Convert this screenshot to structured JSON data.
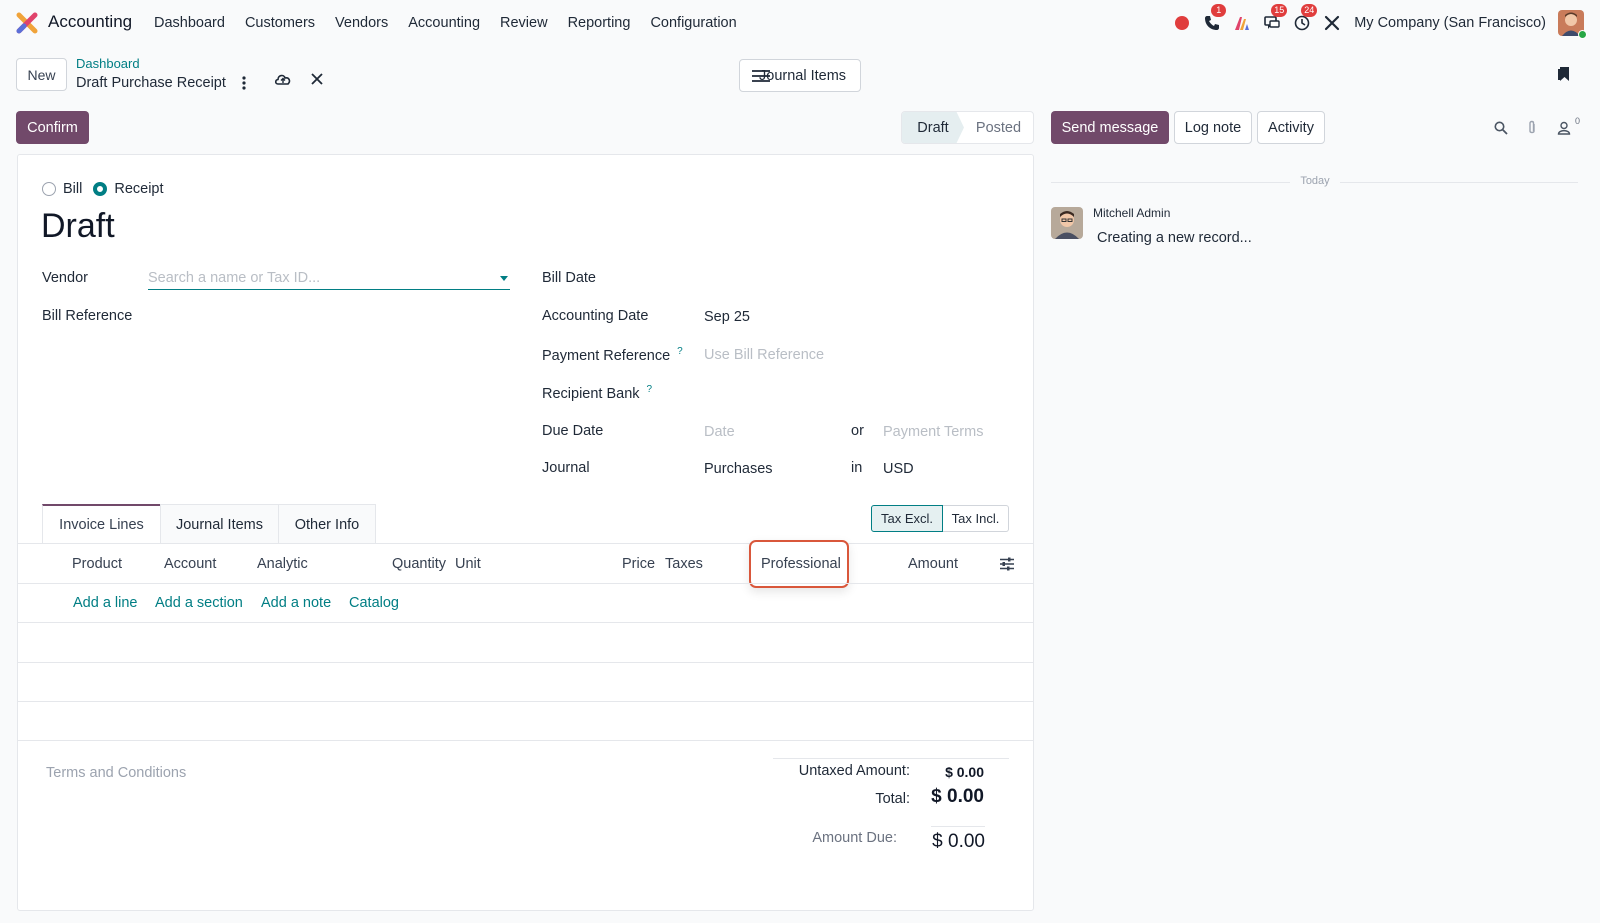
{
  "app": {
    "name": "Accounting"
  },
  "menu": [
    "Dashboard",
    "Customers",
    "Vendors",
    "Accounting",
    "Review",
    "Reporting",
    "Configuration"
  ],
  "systray": {
    "items": [
      {
        "icon": "record-dot-icon",
        "badge": ""
      },
      {
        "icon": "phone-icon",
        "badge": "1"
      },
      {
        "icon": "ai-icon",
        "badge": ""
      },
      {
        "icon": "chat-icon",
        "badge": "15"
      },
      {
        "icon": "clock-icon",
        "badge": "24"
      },
      {
        "icon": "tools-icon",
        "badge": ""
      }
    ],
    "company": "My Company (San Francisco)"
  },
  "control_panel": {
    "new_label": "New",
    "breadcrumb": "Dashboard",
    "record_name": "Draft Purchase Receipt",
    "journal_items_label": "Journal Items",
    "confirm_label": "Confirm",
    "status": [
      "Draft",
      "Posted"
    ]
  },
  "chatter": {
    "send_message": "Send message",
    "log_note": "Log note",
    "activity": "Activity",
    "follower_count": "0",
    "today": "Today",
    "message": {
      "author": "Mitchell Admin",
      "body": "Creating a new record..."
    }
  },
  "form": {
    "type_options": [
      "Bill",
      "Receipt"
    ],
    "selected_type": "Receipt",
    "title": "Draft",
    "vendor_label": "Vendor",
    "vendor_placeholder": "Search a name or Tax ID...",
    "bill_reference_label": "Bill Reference",
    "bill_date_label": "Bill Date",
    "accounting_date_label": "Accounting Date",
    "accounting_date_value": "Sep 25",
    "payment_reference_label": "Payment Reference",
    "payment_reference_placeholder": "Use Bill Reference",
    "recipient_bank_label": "Recipient Bank",
    "help_mark": "?",
    "due_date_label": "Due Date",
    "due_date_placeholder": "Date",
    "or_label": "or",
    "payment_terms_placeholder": "Payment Terms",
    "journal_label": "Journal",
    "journal_value": "Purchases",
    "in_label": "in",
    "currency_value": "USD",
    "tax_excl": "Tax Excl.",
    "tax_incl": "Tax Incl."
  },
  "tabs": [
    "Invoice Lines",
    "Journal Items",
    "Other Info"
  ],
  "table": {
    "columns": [
      "Product",
      "Account",
      "Analytic",
      "Quantity",
      "Unit",
      "Price",
      "Taxes",
      "Professional",
      "Amount"
    ],
    "actions": [
      "Add a line",
      "Add a section",
      "Add a note",
      "Catalog"
    ]
  },
  "footer": {
    "terms_placeholder": "Terms and Conditions",
    "untaxed_label": "Untaxed Amount:",
    "untaxed_value": "$ 0.00",
    "total_label": "Total:",
    "total_value": "$ 0.00",
    "amount_due_label": "Amount Due:",
    "amount_due_value": "$ 0.00"
  },
  "colors": {
    "brand": "#71496a",
    "accent": "#017e84",
    "highlight": "#d9573b",
    "badge": "#e03d3d"
  }
}
